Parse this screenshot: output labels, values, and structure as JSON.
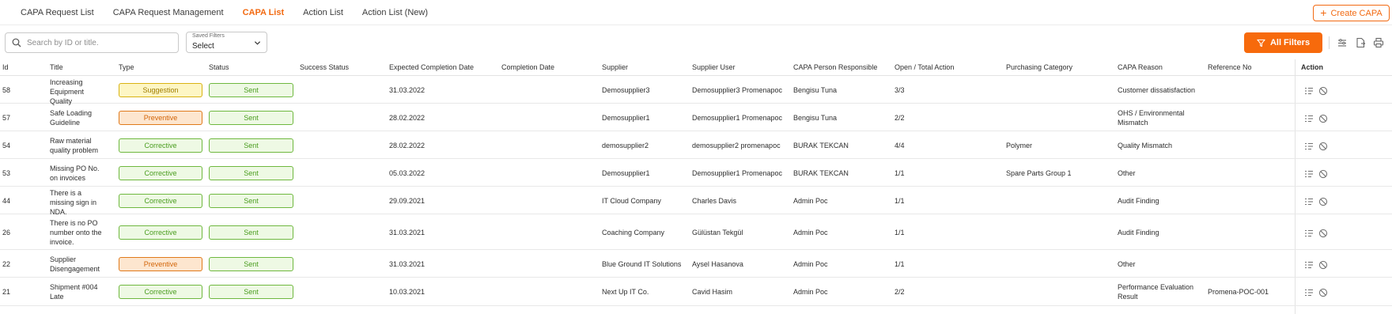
{
  "tabs": [
    {
      "label": "CAPA Request List",
      "active": false
    },
    {
      "label": "CAPA Request Management",
      "active": false
    },
    {
      "label": "CAPA List",
      "active": true
    },
    {
      "label": "Action List",
      "active": false
    },
    {
      "label": "Action List (New)",
      "active": false
    }
  ],
  "create_button": {
    "label": "Create CAPA",
    "icon": "plus-icon"
  },
  "search": {
    "placeholder": "Search by ID or title.",
    "value": ""
  },
  "saved_filters": {
    "label": "Saved Filters",
    "value": "Select"
  },
  "all_filters": {
    "label": "All Filters",
    "icon": "filter-icon"
  },
  "toolbar_icons": [
    "column-settings-icon",
    "export-icon",
    "print-icon"
  ],
  "colors": {
    "accent": "#f76a0c",
    "sent": "#4a9d1f",
    "suggestion": "#d9b313",
    "preventive": "#e07a1b",
    "corrective": "#6fb83f"
  },
  "columns": [
    "Id",
    "Title",
    "Type",
    "Status",
    "Success Status",
    "Expected Completion Date",
    "Completion Date",
    "Supplier",
    "Supplier User",
    "CAPA Person Responsible",
    "Open / Total Action",
    "Purchasing Category",
    "CAPA Reason",
    "Reference No",
    "Action"
  ],
  "rows": [
    {
      "id": "58",
      "title": "Increasing Equipment Quality",
      "type": "Suggestion",
      "status": "Sent",
      "success_status": "",
      "expected": "31.03.2022",
      "completion": "",
      "supplier": "Demosupplier3",
      "supplier_user": "Demosupplier3 Promenapoc",
      "responsible": "Bengisu Tuna",
      "actions": "3/3",
      "category": "",
      "reason": "Customer dissatisfaction",
      "reference": ""
    },
    {
      "id": "57",
      "title": "Safe Loading Guideline",
      "type": "Preventive",
      "status": "Sent",
      "success_status": "",
      "expected": "28.02.2022",
      "completion": "",
      "supplier": "Demosupplier1",
      "supplier_user": "Demosupplier1 Promenapoc",
      "responsible": "Bengisu Tuna",
      "actions": "2/2",
      "category": "",
      "reason": "OHS / Environmental Mismatch",
      "reference": ""
    },
    {
      "id": "54",
      "title": "Raw material quality problem",
      "type": "Corrective",
      "status": "Sent",
      "success_status": "",
      "expected": "28.02.2022",
      "completion": "",
      "supplier": "demosupplier2",
      "supplier_user": "demosupplier2 promenapoc",
      "responsible": "BURAK TEKCAN",
      "actions": "4/4",
      "category": "Polymer",
      "reason": "Quality Mismatch",
      "reference": ""
    },
    {
      "id": "53",
      "title": "Missing PO No. on invoices",
      "type": "Corrective",
      "status": "Sent",
      "success_status": "",
      "expected": "05.03.2022",
      "completion": "",
      "supplier": "Demosupplier1",
      "supplier_user": "Demosupplier1 Promenapoc",
      "responsible": "BURAK TEKCAN",
      "actions": "1/1",
      "category": "Spare Parts Group 1",
      "reason": "Other",
      "reference": ""
    },
    {
      "id": "44",
      "title": "There is a missing sign in NDA.",
      "type": "Corrective",
      "status": "Sent",
      "success_status": "",
      "expected": "29.09.2021",
      "completion": "",
      "supplier": "IT Cloud Company",
      "supplier_user": "Charles Davis",
      "responsible": "Admin Poc",
      "actions": "1/1",
      "category": "",
      "reason": "Audit Finding",
      "reference": ""
    },
    {
      "id": "26",
      "title": "There is no PO number onto the invoice.",
      "type": "Corrective",
      "status": "Sent",
      "success_status": "",
      "expected": "31.03.2021",
      "completion": "",
      "supplier": "Coaching Company",
      "supplier_user": "Gülüstan Tekgül",
      "responsible": "Admin Poc",
      "actions": "1/1",
      "category": "",
      "reason": "Audit Finding",
      "reference": ""
    },
    {
      "id": "22",
      "title": "Supplier Disengagement",
      "type": "Preventive",
      "status": "Sent",
      "success_status": "",
      "expected": "31.03.2021",
      "completion": "",
      "supplier": "Blue Ground IT Solutions",
      "supplier_user": "Aysel Hasanova",
      "responsible": "Admin Poc",
      "actions": "1/1",
      "category": "",
      "reason": "Other",
      "reference": ""
    },
    {
      "id": "21",
      "title": "Shipment #004 Late",
      "type": "Corrective",
      "status": "Sent",
      "success_status": "",
      "expected": "10.03.2021",
      "completion": "",
      "supplier": "Next Up IT Co.",
      "supplier_user": "Cavid Hasim",
      "responsible": "Admin Poc",
      "actions": "2/2",
      "category": "",
      "reason": "Performance Evaluation Result",
      "reference": "Promena-POC-001"
    }
  ],
  "row_action_icons": [
    "details-list-icon",
    "cancel-icon"
  ]
}
